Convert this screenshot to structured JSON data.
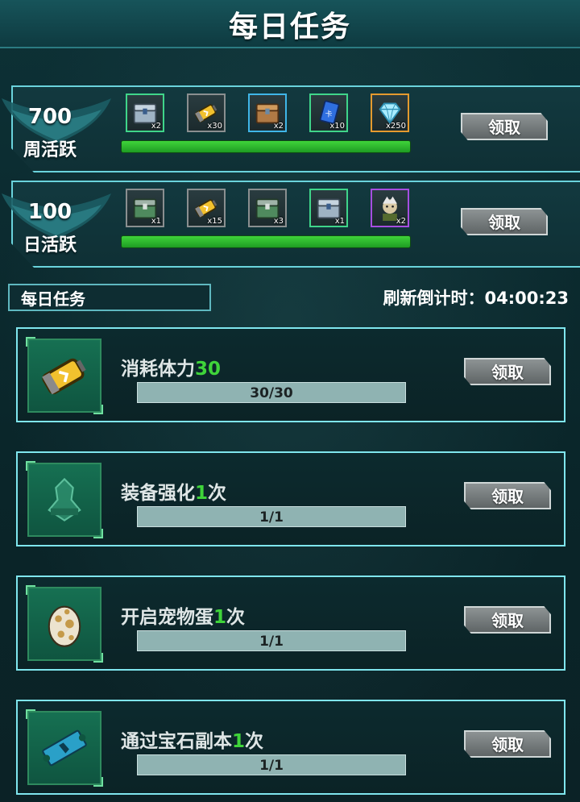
{
  "header": {
    "title": "每日任务"
  },
  "weekly": {
    "points": "700",
    "label": "周活跃",
    "claim_label": "领取",
    "progress": 1.0,
    "rewards": [
      {
        "icon": "silver-chest-icon",
        "count": "x2",
        "border": "#3fd58a"
      },
      {
        "icon": "stamina-battery-icon",
        "count": "x30",
        "border": "#8a8f90"
      },
      {
        "icon": "bronze-chest-icon",
        "count": "x2",
        "border": "#3fb6e8"
      },
      {
        "icon": "blue-card-icon",
        "count": "x10",
        "border": "#3fd58a"
      },
      {
        "icon": "diamond-icon",
        "count": "x250",
        "border": "#e59a2e"
      }
    ]
  },
  "daily": {
    "points": "100",
    "label": "日活跃",
    "claim_label": "领取",
    "progress": 1.0,
    "rewards": [
      {
        "icon": "green-chest-icon",
        "count": "x1",
        "border": "#8a8f90"
      },
      {
        "icon": "stamina-battery-icon",
        "count": "x15",
        "border": "#8a8f90"
      },
      {
        "icon": "green-chest-icon",
        "count": "x3",
        "border": "#8a8f90"
      },
      {
        "icon": "silver-chest-icon",
        "count": "x1",
        "border": "#3fd58a"
      },
      {
        "icon": "hero-portrait-icon",
        "count": "x2",
        "border": "#a64ee0"
      }
    ]
  },
  "section": {
    "title": "每日任务",
    "refresh_label": "刷新倒计时：",
    "refresh_time": "04:00:23"
  },
  "tasks": [
    {
      "icon": "stamina-battery-icon",
      "name": "消耗体力",
      "highlight": "30",
      "suffix": "",
      "progress": "30/30",
      "claim": "领取"
    },
    {
      "icon": "equipment-enhance-icon",
      "name": "装备强化",
      "highlight": "1",
      "suffix": "次",
      "progress": "1/1",
      "claim": "领取"
    },
    {
      "icon": "pet-egg-icon",
      "name": "开启宠物蛋",
      "highlight": "1",
      "suffix": "次",
      "progress": "1/1",
      "claim": "领取"
    },
    {
      "icon": "gem-dungeon-ticket-icon",
      "name": "通过宝石副本",
      "highlight": "1",
      "suffix": "次",
      "progress": "1/1",
      "claim": "领取"
    }
  ]
}
